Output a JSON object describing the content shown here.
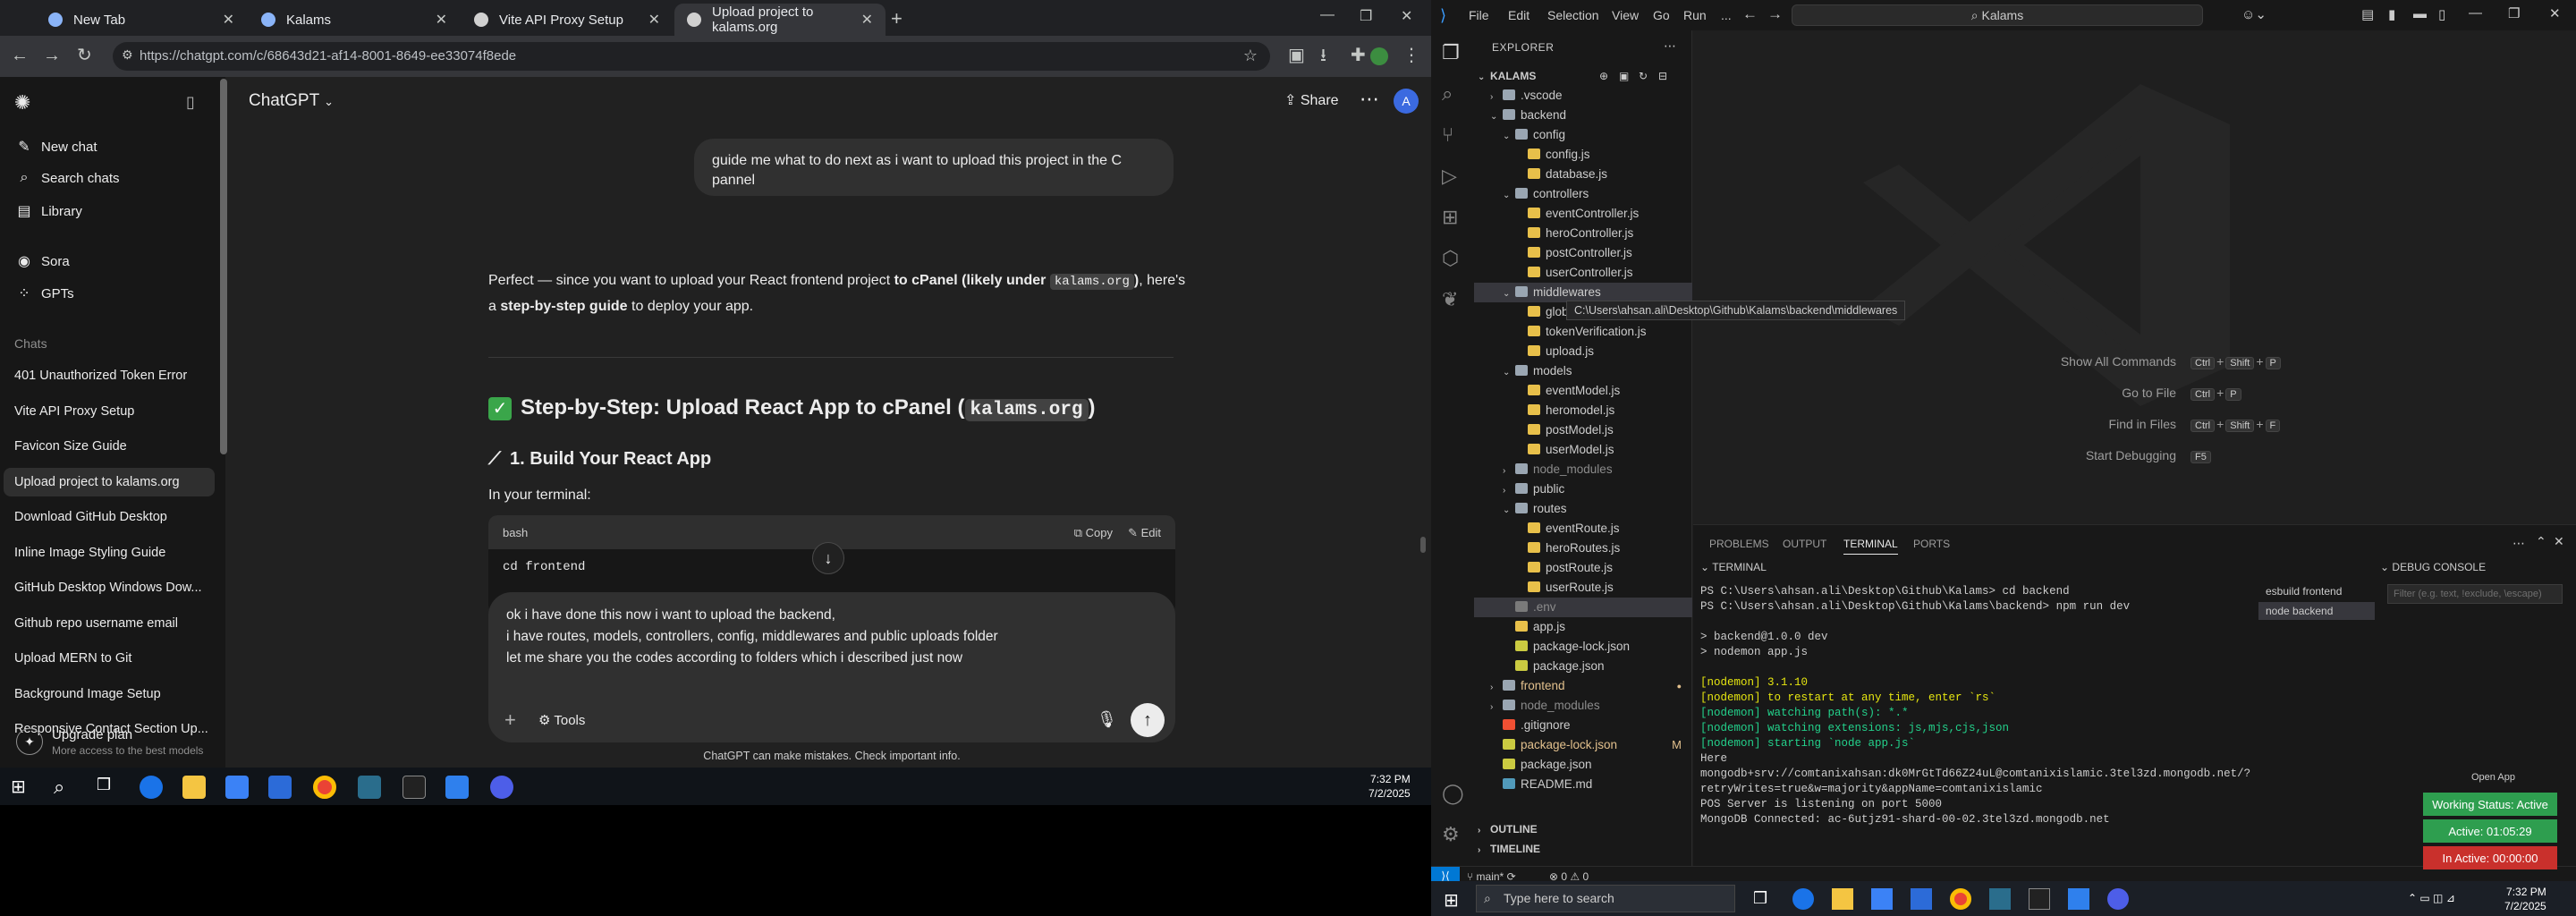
{
  "chrome": {
    "tabs": [
      {
        "label": "New Tab",
        "color": "#8ab4f8"
      },
      {
        "label": "Kalams",
        "color": "#8ab4f8"
      },
      {
        "label": "Vite API Proxy Setup",
        "color": "#e8eaed"
      },
      {
        "label": "Upload project to kalams.org",
        "color": "#e8eaed"
      }
    ],
    "url": "https://chatgpt.com/c/68643d21-af14-8001-8649-ee33074f8ede"
  },
  "chatgpt": {
    "sidebar": {
      "new_chat": "New chat",
      "search": "Search chats",
      "library": "Library",
      "sora": "Sora",
      "gpts": "GPTs",
      "chats_label": "Chats",
      "chats": [
        "401 Unauthorized Token Error",
        "Vite API Proxy Setup",
        "Favicon Size Guide",
        "Upload project to kalams.org",
        "Download GitHub Desktop",
        "Inline Image Styling Guide",
        "GitHub Desktop Windows Dow...",
        "Github repo username email",
        "Upload MERN to Git",
        "Background Image Setup",
        "Responsive Contact Section Up..."
      ],
      "upgrade_title": "Upgrade plan",
      "upgrade_sub": "More access to the best models"
    },
    "header": {
      "title": "ChatGPT",
      "share": "Share",
      "avatar": "A"
    },
    "user_message": "guide me what to do next as i want to upload this project in the C pannel",
    "assistant": {
      "intro_1": "Perfect — since you want to upload your React frontend project ",
      "intro_bold_1": "to cPanel (likely under ",
      "intro_code": "kalams.org",
      "intro_bold_2": ")",
      "intro_2": ", here's",
      "intro_3": "a ",
      "intro_bold_3": "step-by-step guide",
      "intro_4": " to deploy your app.",
      "heading_prefix": "Step-by-Step: Upload React App to cPanel (",
      "heading_code": "kalams.org",
      "heading_suffix": ")",
      "step1": "1. Build Your React App",
      "in_terminal": "In your terminal:",
      "code_lang": "bash",
      "copy": "Copy",
      "edit": "Edit",
      "code_line": "cd frontend"
    },
    "composer": {
      "line1": "ok i have done this now i want to upload the backend,",
      "line2": "i have routes, models, controllers, config, middlewares and public uploads folder",
      "line3": "let me share you the codes according to folders which i described just now",
      "tools": "Tools"
    },
    "disclaimer": "ChatGPT can make mistakes. Check important info."
  },
  "taskbar_left": {
    "time": "7:32 PM",
    "date": "7/2/2025"
  },
  "vscode": {
    "menu": [
      "File",
      "Edit",
      "Selection",
      "View",
      "Go",
      "Run",
      "..."
    ],
    "search": "Kalams",
    "explorer_title": "EXPLORER",
    "root": "KALAMS",
    "tree": [
      {
        "label": ".vscode",
        "depth": 1,
        "type": "folder",
        "open": false
      },
      {
        "label": "backend",
        "depth": 1,
        "type": "folder",
        "open": true
      },
      {
        "label": "config",
        "depth": 2,
        "type": "folder",
        "open": true
      },
      {
        "label": "config.js",
        "depth": 3,
        "type": "js"
      },
      {
        "label": "database.js",
        "depth": 3,
        "type": "js"
      },
      {
        "label": "controllers",
        "depth": 2,
        "type": "folder",
        "open": true
      },
      {
        "label": "eventController.js",
        "depth": 3,
        "type": "js"
      },
      {
        "label": "heroController.js",
        "depth": 3,
        "type": "js"
      },
      {
        "label": "postController.js",
        "depth": 3,
        "type": "js"
      },
      {
        "label": "userController.js",
        "depth": 3,
        "type": "js"
      },
      {
        "label": "middlewares",
        "depth": 2,
        "type": "folder",
        "open": true,
        "selected": true
      },
      {
        "label": "globa",
        "depth": 3,
        "type": "js"
      },
      {
        "label": "tokenVerification.js",
        "depth": 3,
        "type": "js"
      },
      {
        "label": "upload.js",
        "depth": 3,
        "type": "js"
      },
      {
        "label": "models",
        "depth": 2,
        "type": "folder",
        "open": true
      },
      {
        "label": "eventModel.js",
        "depth": 3,
        "type": "js"
      },
      {
        "label": "heromodel.js",
        "depth": 3,
        "type": "js"
      },
      {
        "label": "postModel.js",
        "depth": 3,
        "type": "js"
      },
      {
        "label": "userModel.js",
        "depth": 3,
        "type": "js"
      },
      {
        "label": "node_modules",
        "depth": 2,
        "type": "folder",
        "open": false,
        "dim": true
      },
      {
        "label": "public",
        "depth": 2,
        "type": "folder",
        "open": false
      },
      {
        "label": "routes",
        "depth": 2,
        "type": "folder",
        "open": true
      },
      {
        "label": "eventRoute.js",
        "depth": 3,
        "type": "js"
      },
      {
        "label": "heroRoutes.js",
        "depth": 3,
        "type": "js"
      },
      {
        "label": "postRoute.js",
        "depth": 3,
        "type": "js"
      },
      {
        "label": "userRoute.js",
        "depth": 3,
        "type": "js"
      },
      {
        "label": ".env",
        "depth": 2,
        "type": "env",
        "dim": true,
        "selected_bg": true
      },
      {
        "label": "app.js",
        "depth": 2,
        "type": "js"
      },
      {
        "label": "package-lock.json",
        "depth": 2,
        "type": "json"
      },
      {
        "label": "package.json",
        "depth": 2,
        "type": "json"
      },
      {
        "label": "frontend",
        "depth": 1,
        "type": "folder",
        "open": false,
        "mod": true
      },
      {
        "label": "node_modules",
        "depth": 1,
        "type": "folder",
        "open": false,
        "dim": true
      },
      {
        "label": ".gitignore",
        "depth": 1,
        "type": "git"
      },
      {
        "label": "package-lock.json",
        "depth": 1,
        "type": "json",
        "mod": true,
        "badge": "M"
      },
      {
        "label": "package.json",
        "depth": 1,
        "type": "json"
      },
      {
        "label": "README.md",
        "depth": 1,
        "type": "md"
      }
    ],
    "tooltip": "C:\\Users\\ahsan.ali\\Desktop\\Github\\Kalams\\backend\\middlewares",
    "outline": "OUTLINE",
    "timeline": "TIMELINE",
    "shortcuts": [
      {
        "label": "Show All Commands",
        "keys": [
          "Ctrl",
          "+",
          "Shift",
          "+",
          "P"
        ]
      },
      {
        "label": "Go to File",
        "keys": [
          "Ctrl",
          "+",
          "P"
        ]
      },
      {
        "label": "Find in Files",
        "keys": [
          "Ctrl",
          "+",
          "Shift",
          "+",
          "F"
        ]
      },
      {
        "label": "Start Debugging",
        "keys": [
          "F5"
        ]
      }
    ],
    "panel_tabs": [
      "PROBLEMS",
      "OUTPUT",
      "TERMINAL",
      "PORTS"
    ],
    "terminal_label": "TERMINAL",
    "debug_label": "DEBUG CONSOLE",
    "debug_filter": "Filter (e.g. text, !exclude, \\escape)",
    "terminal_lines": [
      "PS C:\\Users\\ahsan.ali\\Desktop\\Github\\Kalams> cd backend",
      "PS C:\\Users\\ahsan.ali\\Desktop\\Github\\Kalams\\backend> npm run dev",
      "",
      "> backend@1.0.0 dev",
      "> nodemon app.js",
      "",
      "[nodemon] 3.1.10",
      "[nodemon] to restart at any time, enter `rs`",
      "[nodemon] watching path(s): *.*",
      "[nodemon] watching extensions: js,mjs,cjs,json",
      "[nodemon] starting `node app.js`",
      "Here",
      "mongodb+srv://comtanixahsan:dk0MrGtTd66Z24uL@comtanixislamic.3tel3zd.mongodb.net/?",
      "retryWrites=true&w=majority&appName=comtanixislamic",
      "POS Server is listening on port 5000",
      "MongoDB Connected: ac-6utjz91-shard-00-02.3tel3zd.mongodb.net"
    ],
    "term_list": [
      "esbuild  frontend",
      "node  backend"
    ],
    "status_left": "main*",
    "status_errors": "0 ⚠ 0",
    "open_app": "Open App",
    "working_status": "Working Status: Active",
    "active_time": "Active: 01:05:29",
    "inactive_time": "In Active: 00:00:00"
  },
  "taskbar_right": {
    "search": "Type here to search",
    "time": "7:32 PM",
    "date": "7/2/2025"
  }
}
